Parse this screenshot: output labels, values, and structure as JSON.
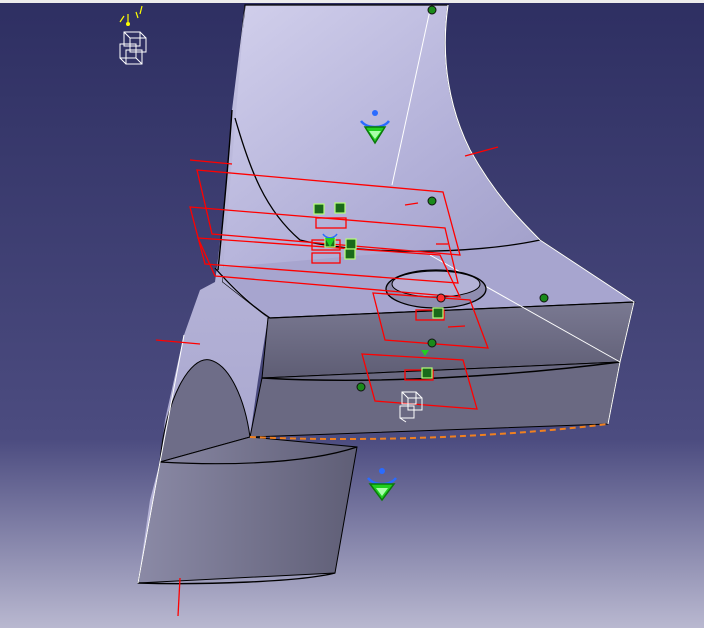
{
  "viewport": {
    "label": "",
    "background_top": "#2e2f62",
    "background_bottom": "#b9b8d0"
  },
  "part": {
    "face_light": "#b4b2d8",
    "face_mid": "#9896c2",
    "face_dark": "#6c6b86",
    "face_shadow": "#5a5a74",
    "edge_color": "#000000",
    "silhouette_color": "#ffffff"
  },
  "annotations": {
    "constraint_color": "#ff0000",
    "marker_color": "#22c422",
    "compass_top_color": "#2060ff",
    "boundary_color": "#ff8800",
    "axis_color": "#ffff00"
  },
  "icons": {
    "axis_triad": "xyz-axis-icon",
    "compass": "compass-icon",
    "geometry_marker": "geometry-marker-icon"
  }
}
